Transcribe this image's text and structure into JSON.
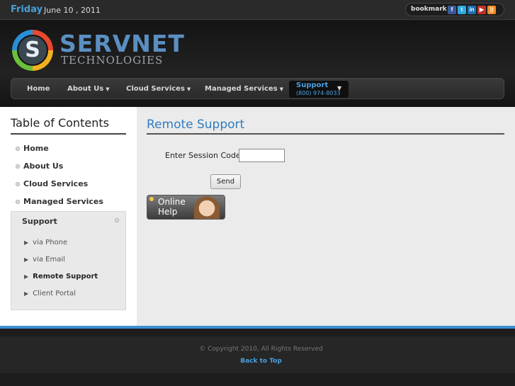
{
  "topbar": {
    "day": "Friday",
    "date": "June 10 , 2011",
    "bookmark_label": "bookmark",
    "social_icons": [
      "facebook-icon",
      "twitter-icon",
      "linkedin-icon",
      "youtube-icon",
      "rss-icon"
    ]
  },
  "brand": {
    "logo_letter": "S",
    "name": "SERVNET",
    "tagline": "TECHNOLOGIES"
  },
  "nav": {
    "items": [
      {
        "label": "Home"
      },
      {
        "label": "About Us"
      },
      {
        "label": "Cloud Services"
      },
      {
        "label": "Managed Services"
      }
    ],
    "active": {
      "label": "Support",
      "phone": "(800) 974-8033"
    }
  },
  "sidebar": {
    "title": "Table of Contents",
    "links": [
      "Home",
      "About Us",
      "Cloud Services",
      "Managed Services"
    ],
    "submenu": {
      "title": "Support",
      "items": [
        {
          "label": "via Phone"
        },
        {
          "label": "via Email"
        },
        {
          "label": "Remote Support"
        },
        {
          "label": "Client Portal"
        }
      ],
      "active_item": "Remote Support"
    }
  },
  "main": {
    "title": "Remote Support",
    "session_label": "Enter Session Code:",
    "session_value": "",
    "send_label": "Send",
    "help_line1": "Online",
    "help_line2": "Help"
  },
  "footer": {
    "copyright": "© Copyright 2010, All Rights Reserved",
    "back_to_top": "Back to Top"
  },
  "colors": {
    "accent": "#3a8fd0",
    "title_blue": "#2f7cc0",
    "background": "#1a1a1a"
  }
}
